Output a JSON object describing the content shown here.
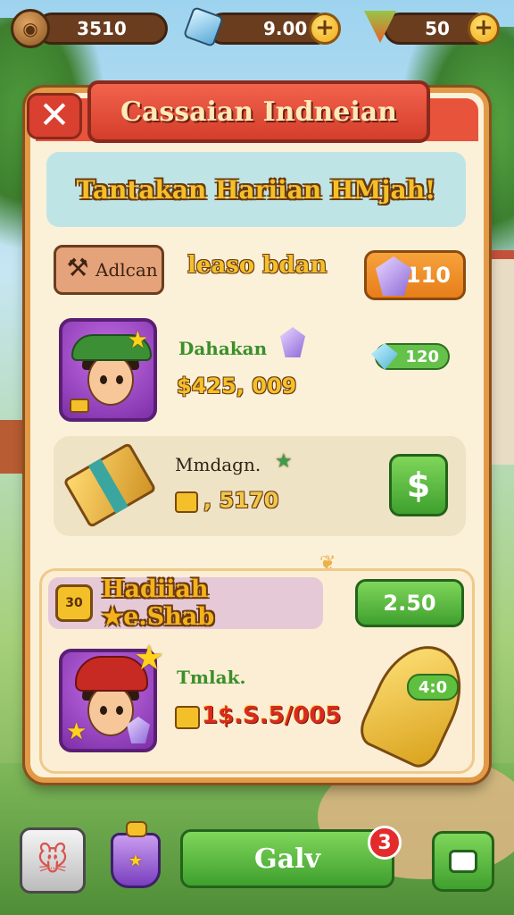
{
  "hud": {
    "coins_value": "3510",
    "gems_value": "9.00",
    "food_value": "50",
    "plus_label": "+"
  },
  "dialog": {
    "title": "Cassaian Indneian",
    "subtitle": "Tantakan Hariian HMjah!",
    "close_label": "✕"
  },
  "row1": {
    "tag_label": "Adlcan",
    "label": "leaso bdan",
    "button_value": "110"
  },
  "row2": {
    "name": "Dahakan",
    "amount": "$425, 009",
    "gem_value": "120"
  },
  "row3": {
    "name": "Mmdagn.",
    "amount": ", 5170",
    "button_label": "$"
  },
  "section2": {
    "badge": "30",
    "title": "Hadiiah ★e.Shab",
    "button_value": "2.50",
    "name": "Tmlak.",
    "amount": "1$.S.5/005",
    "rocket_tag": "4:0"
  },
  "bottom": {
    "go_label": "Galv",
    "notification_count": "3"
  },
  "colors": {
    "title_red": "#e8533c",
    "panel_border": "#e39a46",
    "button_green": "#3fa02e",
    "button_orange": "#e77e1a",
    "gold": "#f4c02a"
  }
}
